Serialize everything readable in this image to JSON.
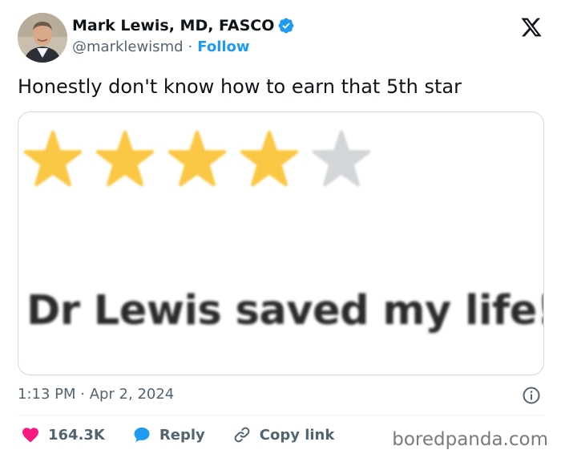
{
  "author": {
    "name": "Mark Lewis, MD, FASCO",
    "handle": "@marklewismd",
    "separator": "·",
    "follow_label": "Follow",
    "verified": true,
    "avatar_icon": "profile-photo"
  },
  "tweet": {
    "text": "Honestly don't know how to earn that 5th star"
  },
  "media": {
    "rating": 4,
    "max_rating": 5,
    "star_color_filled": "#fbc845",
    "star_color_empty": "#d3d6d8",
    "review_text": "Dr Lewis saved my life!"
  },
  "meta": {
    "timestamp": "1:13 PM · Apr 2, 2024"
  },
  "actions": {
    "likes": "164.3K",
    "reply_label": "Reply",
    "copy_link_label": "Copy link"
  },
  "watermark": "boredpanda.com",
  "colors": {
    "accent": "#1d9bf0",
    "like": "#f91880",
    "text": "#0f1419",
    "secondary": "#536471"
  }
}
